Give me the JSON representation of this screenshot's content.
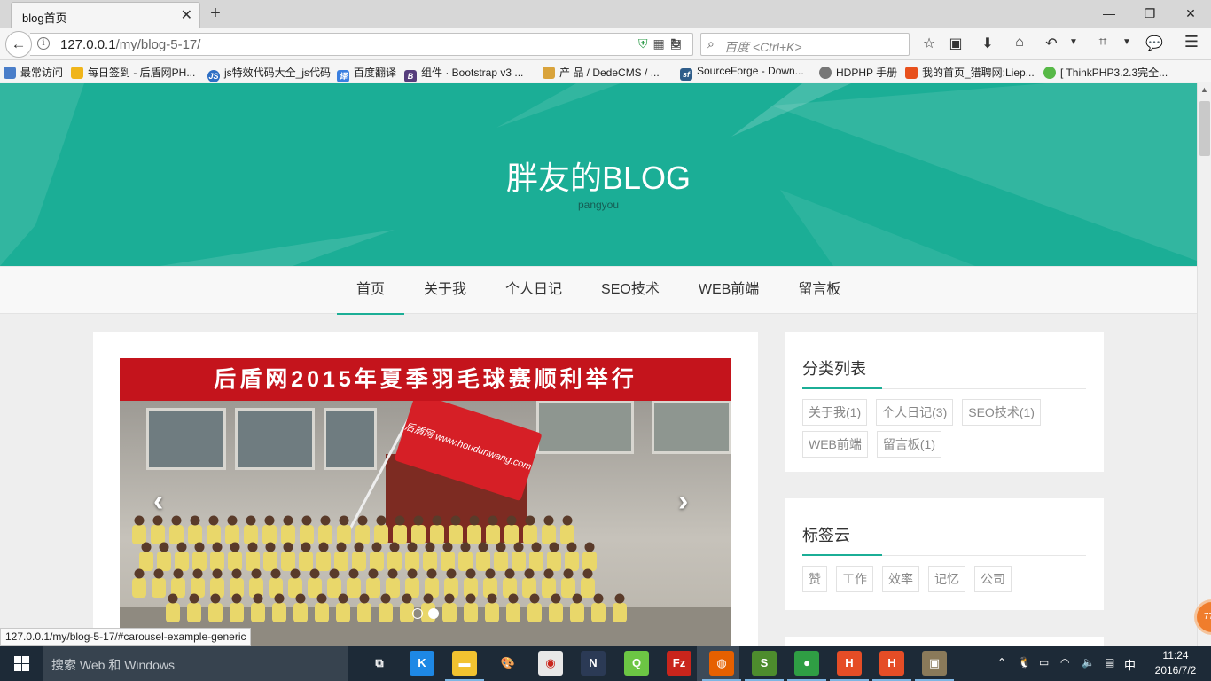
{
  "browser": {
    "tab_title": "blog首页",
    "tab_close": "✕",
    "new_tab": "+",
    "url_host": "127.0.0.1",
    "url_path": "/my/blog-5-17/",
    "search_placeholder": "百度 <Ctrl+K>",
    "window_controls": {
      "minimize": "—",
      "restore": "❐",
      "close": "✕"
    },
    "toolbar_icons": [
      "star-icon",
      "reading-list-icon",
      "download-icon",
      "home-icon",
      "undo-icon",
      "screenshot-icon",
      "chat-icon",
      "menu-icon"
    ]
  },
  "bookmarks": [
    {
      "label": "最常访问",
      "icon": "bookmarks-icon",
      "color": "#4a7ec9"
    },
    {
      "label": "每日签到 - 后盾网PH...",
      "icon": "hand-icon",
      "color": "#f0b51a"
    },
    {
      "label": "js特效代码大全_js代码",
      "icon": "js-icon",
      "color": "#2e6fc4"
    },
    {
      "label": "百度翻译",
      "icon": "translate-icon",
      "color": "#3a7fe0"
    },
    {
      "label": "组件 · Bootstrap v3 ...",
      "icon": "bootstrap-icon",
      "color": "#563d7c"
    },
    {
      "label": "产 品 / DedeCMS / ...",
      "icon": "dedecms-icon",
      "color": "#d9a33b"
    },
    {
      "label": "SourceForge - Down...",
      "icon": "sourceforge-icon",
      "color": "#2f5d8a"
    },
    {
      "label": "HDPHP 手册",
      "icon": "globe-icon",
      "color": "#777777"
    },
    {
      "label": "我的首页_猎聘网:Liep...",
      "icon": "liepin-icon",
      "color": "#e8501c"
    },
    {
      "label": "[ ThinkPHP3.2.3完全...",
      "icon": "thinkphp-icon",
      "color": "#57b947"
    }
  ],
  "blog": {
    "title": "胖友的BLOG",
    "subtitle": "pangyou",
    "nav": [
      "首页",
      "关于我",
      "个人日记",
      "SEO技术",
      "WEB前端",
      "留言板"
    ],
    "active_nav_index": 0,
    "accent": "#1bae96",
    "carousel": {
      "banner": "后盾网2015年夏季羽毛球赛顺利举行",
      "flag_text": "后盾网 www.houdunwang.com",
      "prev": "‹",
      "next": "›",
      "slides": 2,
      "active_slide": 1
    },
    "sidebar": {
      "categories_title": "分类列表",
      "categories": [
        "关于我(1)",
        "个人日记(3)",
        "SEO技术(1)",
        "WEB前端",
        "留言板(1)"
      ],
      "tags_title": "标签云",
      "tags": [
        "赞",
        "工作",
        "效率",
        "记忆",
        "公司"
      ]
    }
  },
  "status_url": "127.0.0.1/my/blog-5-17/#carousel-example-generic",
  "float_ball": "77",
  "taskbar": {
    "search_placeholder": "搜索 Web 和 Windows",
    "apps": [
      {
        "name": "task-view-icon",
        "label": "⧉",
        "color": "#1d2a37"
      },
      {
        "name": "kugou-icon",
        "label": "K",
        "color": "#1e88e5"
      },
      {
        "name": "file-explorer-icon",
        "label": "▬",
        "color": "#f2c230"
      },
      {
        "name": "paint-icon",
        "label": "🎨",
        "color": "#1d2a37"
      },
      {
        "name": "presentation-icon",
        "label": "◉",
        "color": "#e8e8e8"
      },
      {
        "name": "navicat-icon",
        "label": "N",
        "color": "#2b3a55"
      },
      {
        "name": "qq-game-icon",
        "label": "Q",
        "color": "#6cc644"
      },
      {
        "name": "filezilla-icon",
        "label": "Fz",
        "color": "#c9251c"
      },
      {
        "name": "firefox-icon",
        "label": "◍",
        "color": "#e66000"
      },
      {
        "name": "sublime-icon",
        "label": "S",
        "color": "#4d8c2d"
      },
      {
        "name": "chrome-icon",
        "label": "●",
        "color": "#2f9e44"
      },
      {
        "name": "hbuilder-icon",
        "label": "H",
        "color": "#e54d26"
      },
      {
        "name": "hbuilder2-icon",
        "label": "H",
        "color": "#e54d26"
      },
      {
        "name": "photo-viewer-icon",
        "label": "▣",
        "color": "#8a7a5a"
      }
    ],
    "ime": "中",
    "time": "11:24",
    "date": "2016/7/2"
  }
}
